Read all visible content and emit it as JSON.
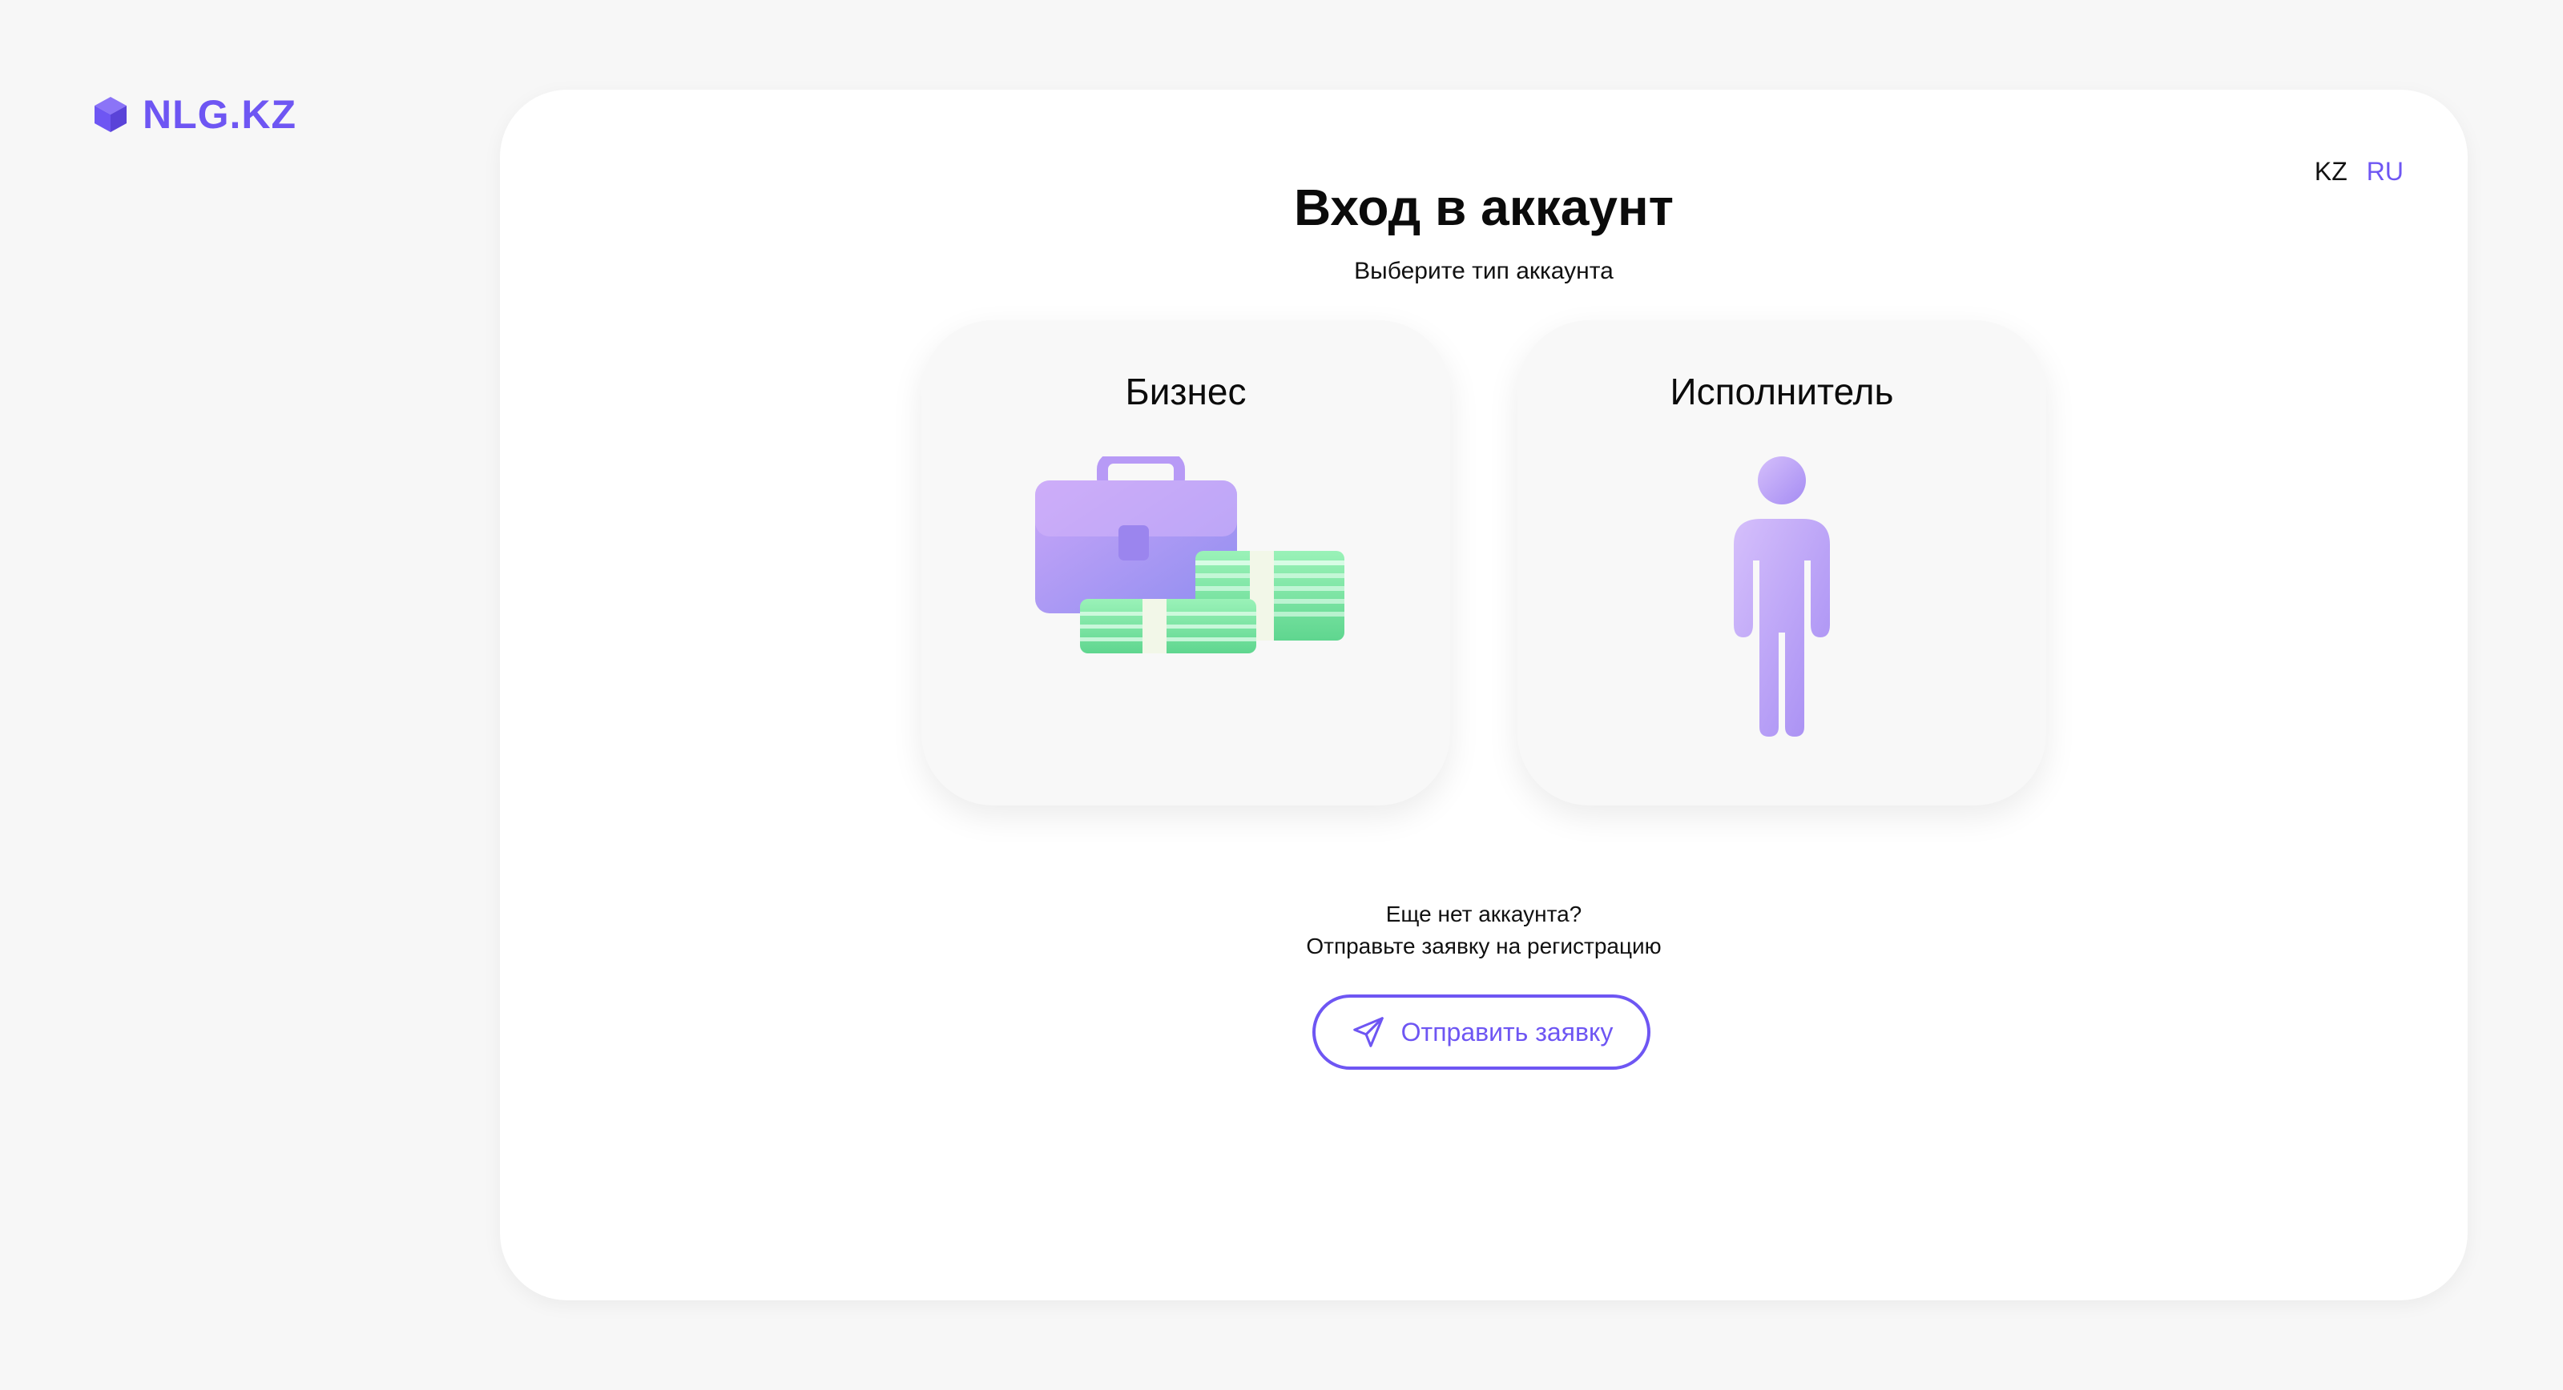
{
  "brand": {
    "name": "NLG.KZ",
    "accent_color": "#6e56f3",
    "icon": "cube-icon"
  },
  "language_switch": {
    "options": [
      "KZ",
      "RU"
    ],
    "active": "RU"
  },
  "login": {
    "title": "Вход в аккаунт",
    "subtitle": "Выберите тип аккаунта"
  },
  "account_types": [
    {
      "label": "Бизнес",
      "icon": "briefcase-money-icon"
    },
    {
      "label": "Исполнитель",
      "icon": "person-icon"
    }
  ],
  "registration": {
    "question": "Еще нет аккаунта?",
    "hint": "Отправьте заявку на регистрацию",
    "button_label": "Отправить заявку",
    "button_icon": "paper-plane-icon"
  }
}
